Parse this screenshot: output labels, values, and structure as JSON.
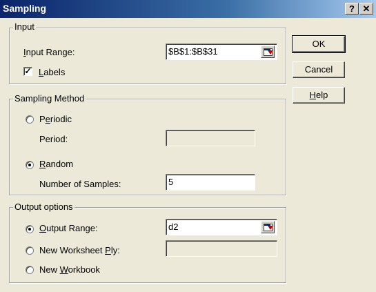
{
  "window": {
    "title": "Sampling",
    "help_glyph": "?",
    "close_glyph": "✕"
  },
  "input": {
    "legend": "Input",
    "range_label": "Input Range:",
    "range_value": "$B$1:$B$31",
    "labels_label": "Labels",
    "labels_checked": true
  },
  "sampling": {
    "legend": "Sampling Method",
    "periodic_label": "Periodic",
    "period_label": "Period:",
    "period_value": "",
    "random_label": "Random",
    "random_selected": true,
    "samples_label": "Number of Samples:",
    "samples_value": "5"
  },
  "output": {
    "legend": "Output options",
    "range_label": "Output Range:",
    "range_value": "d2",
    "range_selected": true,
    "new_ply_label": "New Worksheet Ply:",
    "new_ply_value": "",
    "new_workbook_label": "New Workbook"
  },
  "buttons": {
    "ok": "OK",
    "cancel": "Cancel",
    "help": "Help"
  },
  "colors": {
    "titlebar_start": "#0a246a",
    "titlebar_end": "#a6caf0",
    "dialog_face": "#ece9d8"
  }
}
